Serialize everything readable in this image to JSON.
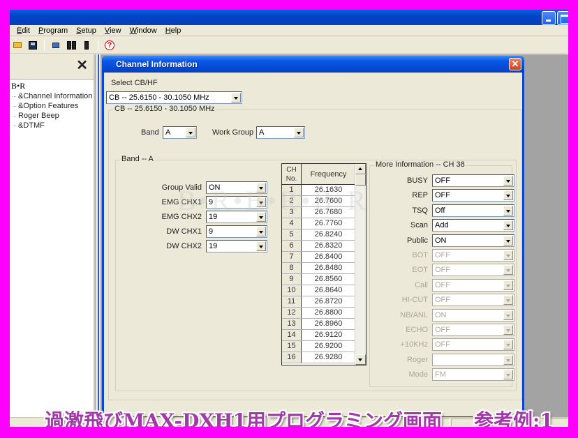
{
  "menubar": {
    "items": [
      {
        "label": "Edit",
        "accel": "E"
      },
      {
        "label": "Program",
        "accel": "P"
      },
      {
        "label": "Setup",
        "accel": "S"
      },
      {
        "label": "View",
        "accel": "V"
      },
      {
        "label": "Window",
        "accel": "W"
      },
      {
        "label": "Help",
        "accel": "H"
      }
    ]
  },
  "toolbar": {
    "icons": [
      "open-folder-icon",
      "save-icon",
      "read-from-radio-icon",
      "radio-clone-icon",
      "write-to-radio-icon",
      "help-icon"
    ]
  },
  "tree": {
    "close_glyph": "✕",
    "root": "B•R",
    "items": [
      "&Channel Information",
      "&Option Features",
      "Roger Beep",
      "&DTMF"
    ]
  },
  "dialog": {
    "title": "Channel Information",
    "close_glyph": "✕",
    "select_label": "Select CB/HF",
    "select_value": "CB -- 25.6150 - 30.1050 MHz",
    "range_group_title": "CB -- 25.6150 - 30.1050 MHz",
    "band_label": "Band",
    "band_value": "A",
    "work_group_label": "Work Group",
    "work_group_value": "A",
    "band_group_title": "Band -- A",
    "band_fields": [
      {
        "label": "Group Valid",
        "value": "ON"
      },
      {
        "label": "EMG CHX1",
        "value": "9"
      },
      {
        "label": "EMG CHX2",
        "value": "19"
      },
      {
        "label": "DW CHX1",
        "value": "9"
      },
      {
        "label": "DW CHX2",
        "value": "19"
      }
    ],
    "table": {
      "col_ch": "CH No.",
      "col_ch_line1": "CH",
      "col_ch_line2": "No.",
      "col_freq": "Frequency",
      "rows": [
        {
          "ch": "1",
          "freq": "26.1630"
        },
        {
          "ch": "2",
          "freq": "26.7600"
        },
        {
          "ch": "3",
          "freq": "26.7680"
        },
        {
          "ch": "4",
          "freq": "26.7760"
        },
        {
          "ch": "5",
          "freq": "26.8240"
        },
        {
          "ch": "6",
          "freq": "26.8320"
        },
        {
          "ch": "7",
          "freq": "26.8400"
        },
        {
          "ch": "8",
          "freq": "26.8480"
        },
        {
          "ch": "9",
          "freq": "26.8560"
        },
        {
          "ch": "10",
          "freq": "26.8640"
        },
        {
          "ch": "11",
          "freq": "26.8720"
        },
        {
          "ch": "12",
          "freq": "26.8800"
        },
        {
          "ch": "13",
          "freq": "26.8960"
        },
        {
          "ch": "14",
          "freq": "26.9120"
        },
        {
          "ch": "15",
          "freq": "26.9200"
        },
        {
          "ch": "16",
          "freq": "26.9280"
        }
      ]
    },
    "more_info_title": "More Information -- CH 38",
    "more_info_fields": [
      {
        "label": "BUSY",
        "value": "OFF",
        "enabled": true
      },
      {
        "label": "REP",
        "value": "OFF",
        "enabled": true
      },
      {
        "label": "TSQ",
        "value": "Off",
        "enabled": true
      },
      {
        "label": "Scan",
        "value": "Add",
        "enabled": true
      },
      {
        "label": "Public",
        "value": "ON",
        "enabled": true
      },
      {
        "label": "BOT",
        "value": "OFF",
        "enabled": false
      },
      {
        "label": "EOT",
        "value": "OFF",
        "enabled": false
      },
      {
        "label": "Call",
        "value": "OFF",
        "enabled": false
      },
      {
        "label": "HI-CUT",
        "value": "OFF",
        "enabled": false
      },
      {
        "label": "NB/ANL",
        "value": "ON",
        "enabled": false
      },
      {
        "label": "ECHO",
        "value": "OFF",
        "enabled": false
      },
      {
        "label": "+10KHz",
        "value": "OFF",
        "enabled": false
      },
      {
        "label": "Roger",
        "value": "",
        "enabled": false
      },
      {
        "label": "Mode",
        "value": "FM",
        "enabled": false
      }
    ]
  },
  "watermark": {
    "text": "B•R•B•R•B•R"
  },
  "caption": {
    "main": "過激飛びMAX-DXH1用プログラミング画面",
    "example": "参考例:1"
  },
  "colors": {
    "page_border": "#ff00ff",
    "xp_blue": "#0a46d2",
    "caption_purple": "#a03aa8",
    "close_red": "#d04020"
  }
}
